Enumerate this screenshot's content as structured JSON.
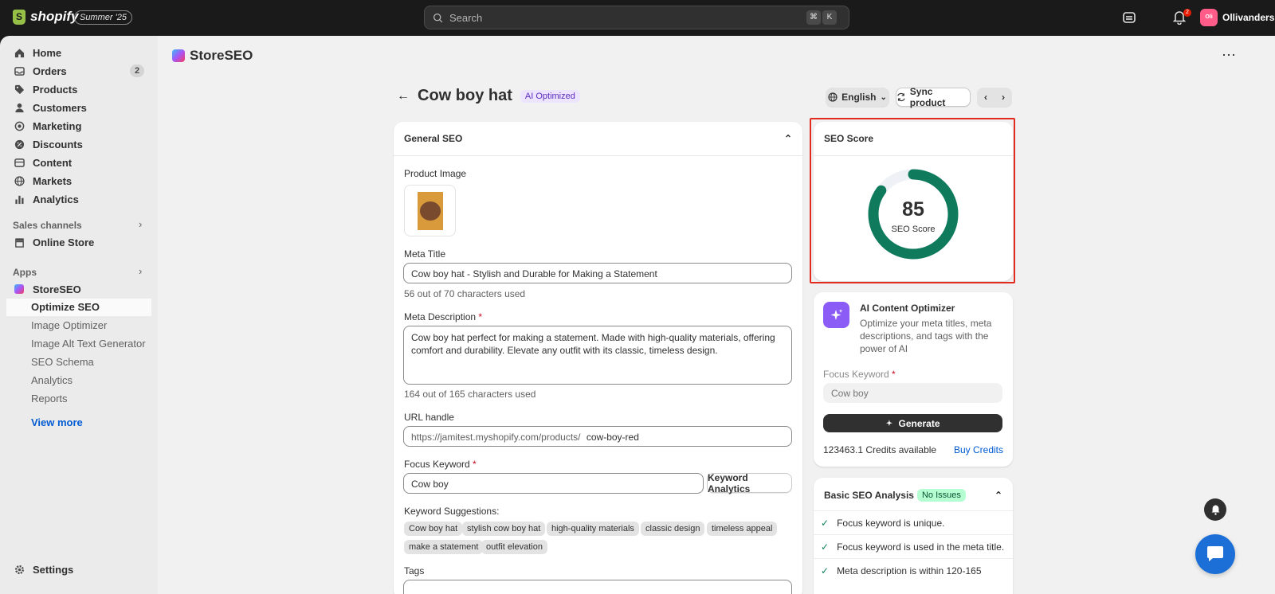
{
  "topbar": {
    "brand": "shopify",
    "edition": "Summer '25",
    "search_placeholder": "Search",
    "kbd_cmd": "⌘",
    "kbd_key": "K",
    "notification_count": "2",
    "store_initials": "Oli",
    "store_name": "Ollivanders"
  },
  "sidebar": {
    "items": [
      {
        "label": "Home",
        "icon": "home-icon"
      },
      {
        "label": "Orders",
        "icon": "inbox-icon",
        "badge": "2"
      },
      {
        "label": "Products",
        "icon": "tag-icon"
      },
      {
        "label": "Customers",
        "icon": "person-icon"
      },
      {
        "label": "Marketing",
        "icon": "target-icon"
      },
      {
        "label": "Discounts",
        "icon": "discount-icon"
      },
      {
        "label": "Content",
        "icon": "content-icon"
      },
      {
        "label": "Markets",
        "icon": "globe-icon"
      },
      {
        "label": "Analytics",
        "icon": "bar-chart-icon"
      }
    ],
    "sales_channels_label": "Sales channels",
    "online_store": "Online Store",
    "apps_label": "Apps",
    "app_name": "StoreSEO",
    "app_sub_items": [
      "Optimize SEO",
      "Image Optimizer",
      "Image Alt Text Generator",
      "SEO Schema",
      "Analytics",
      "Reports"
    ],
    "view_more": "View more",
    "settings": "Settings"
  },
  "app": {
    "title": "StoreSEO"
  },
  "page": {
    "title": "Cow boy hat",
    "badge": "AI Optimized",
    "language": "English",
    "sync_label": "Sync product"
  },
  "general_seo": {
    "heading": "General SEO",
    "product_image_label": "Product Image",
    "meta_title_label": "Meta Title",
    "meta_title_value": "Cow boy hat - Stylish and Durable for Making a Statement",
    "meta_title_help": "56 out of 70 characters used",
    "meta_desc_label": "Meta Description",
    "meta_desc_value": "Cow boy hat perfect for making a statement. Made with high-quality materials, offering comfort and durability. Elevate any outfit with its classic, timeless design.",
    "meta_desc_help": "164 out of 165 characters used",
    "url_label": "URL handle",
    "url_prefix": "https://jamitest.myshopify.com/products/",
    "url_value": "cow-boy-red",
    "focus_label": "Focus Keyword",
    "focus_value": "Cow boy",
    "keyword_analytics": "Keyword Analytics",
    "suggestions_label": "Keyword Suggestions:",
    "suggestions": [
      "Cow boy hat",
      "stylish cow boy hat",
      "high-quality materials",
      "classic design",
      "timeless appeal",
      "make a statement",
      "outfit elevation"
    ],
    "tags_label": "Tags"
  },
  "seo_score": {
    "heading": "SEO Score",
    "value": "85",
    "fraction": 0.85,
    "label": "SEO Score",
    "ring_color": "#0f7a5c"
  },
  "ai_optimizer": {
    "title": "AI Content Optimizer",
    "description": "Optimize your meta titles, meta descriptions, and tags with the power of AI",
    "focus_label": "Focus Keyword",
    "focus_placeholder": "Cow boy",
    "generate": "Generate",
    "credits": "123463.1 Credits available",
    "buy_credits": "Buy Credits"
  },
  "basic_analysis": {
    "title": "Basic SEO Analysis",
    "badge": "No Issues",
    "checks": [
      "Focus keyword is unique.",
      "Focus keyword is used in the meta title.",
      "Meta description is within 120-165"
    ]
  },
  "colors": {
    "accent_blue": "#005bd3",
    "highlight_red": "#e02b1e",
    "success_green": "#0a7d5a"
  }
}
